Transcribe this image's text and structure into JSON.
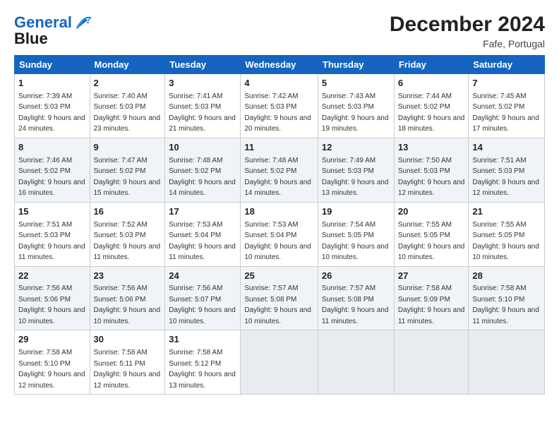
{
  "logo": {
    "line1": "General",
    "line2": "Blue"
  },
  "title": "December 2024",
  "location": "Fafe, Portugal",
  "days_of_week": [
    "Sunday",
    "Monday",
    "Tuesday",
    "Wednesday",
    "Thursday",
    "Friday",
    "Saturday"
  ],
  "weeks": [
    [
      {
        "day": 1,
        "sunrise": "7:39 AM",
        "sunset": "5:03 PM",
        "daylight": "9 hours and 24 minutes."
      },
      {
        "day": 2,
        "sunrise": "7:40 AM",
        "sunset": "5:03 PM",
        "daylight": "9 hours and 23 minutes."
      },
      {
        "day": 3,
        "sunrise": "7:41 AM",
        "sunset": "5:03 PM",
        "daylight": "9 hours and 21 minutes."
      },
      {
        "day": 4,
        "sunrise": "7:42 AM",
        "sunset": "5:03 PM",
        "daylight": "9 hours and 20 minutes."
      },
      {
        "day": 5,
        "sunrise": "7:43 AM",
        "sunset": "5:03 PM",
        "daylight": "9 hours and 19 minutes."
      },
      {
        "day": 6,
        "sunrise": "7:44 AM",
        "sunset": "5:02 PM",
        "daylight": "9 hours and 18 minutes."
      },
      {
        "day": 7,
        "sunrise": "7:45 AM",
        "sunset": "5:02 PM",
        "daylight": "9 hours and 17 minutes."
      }
    ],
    [
      {
        "day": 8,
        "sunrise": "7:46 AM",
        "sunset": "5:02 PM",
        "daylight": "9 hours and 16 minutes."
      },
      {
        "day": 9,
        "sunrise": "7:47 AM",
        "sunset": "5:02 PM",
        "daylight": "9 hours and 15 minutes."
      },
      {
        "day": 10,
        "sunrise": "7:48 AM",
        "sunset": "5:02 PM",
        "daylight": "9 hours and 14 minutes."
      },
      {
        "day": 11,
        "sunrise": "7:48 AM",
        "sunset": "5:02 PM",
        "daylight": "9 hours and 14 minutes."
      },
      {
        "day": 12,
        "sunrise": "7:49 AM",
        "sunset": "5:03 PM",
        "daylight": "9 hours and 13 minutes."
      },
      {
        "day": 13,
        "sunrise": "7:50 AM",
        "sunset": "5:03 PM",
        "daylight": "9 hours and 12 minutes."
      },
      {
        "day": 14,
        "sunrise": "7:51 AM",
        "sunset": "5:03 PM",
        "daylight": "9 hours and 12 minutes."
      }
    ],
    [
      {
        "day": 15,
        "sunrise": "7:51 AM",
        "sunset": "5:03 PM",
        "daylight": "9 hours and 11 minutes."
      },
      {
        "day": 16,
        "sunrise": "7:52 AM",
        "sunset": "5:03 PM",
        "daylight": "9 hours and 11 minutes."
      },
      {
        "day": 17,
        "sunrise": "7:53 AM",
        "sunset": "5:04 PM",
        "daylight": "9 hours and 11 minutes."
      },
      {
        "day": 18,
        "sunrise": "7:53 AM",
        "sunset": "5:04 PM",
        "daylight": "9 hours and 10 minutes."
      },
      {
        "day": 19,
        "sunrise": "7:54 AM",
        "sunset": "5:05 PM",
        "daylight": "9 hours and 10 minutes."
      },
      {
        "day": 20,
        "sunrise": "7:55 AM",
        "sunset": "5:05 PM",
        "daylight": "9 hours and 10 minutes."
      },
      {
        "day": 21,
        "sunrise": "7:55 AM",
        "sunset": "5:05 PM",
        "daylight": "9 hours and 10 minutes."
      }
    ],
    [
      {
        "day": 22,
        "sunrise": "7:56 AM",
        "sunset": "5:06 PM",
        "daylight": "9 hours and 10 minutes."
      },
      {
        "day": 23,
        "sunrise": "7:56 AM",
        "sunset": "5:06 PM",
        "daylight": "9 hours and 10 minutes."
      },
      {
        "day": 24,
        "sunrise": "7:56 AM",
        "sunset": "5:07 PM",
        "daylight": "9 hours and 10 minutes."
      },
      {
        "day": 25,
        "sunrise": "7:57 AM",
        "sunset": "5:08 PM",
        "daylight": "9 hours and 10 minutes."
      },
      {
        "day": 26,
        "sunrise": "7:57 AM",
        "sunset": "5:08 PM",
        "daylight": "9 hours and 11 minutes."
      },
      {
        "day": 27,
        "sunrise": "7:58 AM",
        "sunset": "5:09 PM",
        "daylight": "9 hours and 11 minutes."
      },
      {
        "day": 28,
        "sunrise": "7:58 AM",
        "sunset": "5:10 PM",
        "daylight": "9 hours and 11 minutes."
      }
    ],
    [
      {
        "day": 29,
        "sunrise": "7:58 AM",
        "sunset": "5:10 PM",
        "daylight": "9 hours and 12 minutes."
      },
      {
        "day": 30,
        "sunrise": "7:58 AM",
        "sunset": "5:11 PM",
        "daylight": "9 hours and 12 minutes."
      },
      {
        "day": 31,
        "sunrise": "7:58 AM",
        "sunset": "5:12 PM",
        "daylight": "9 hours and 13 minutes."
      },
      null,
      null,
      null,
      null
    ]
  ]
}
